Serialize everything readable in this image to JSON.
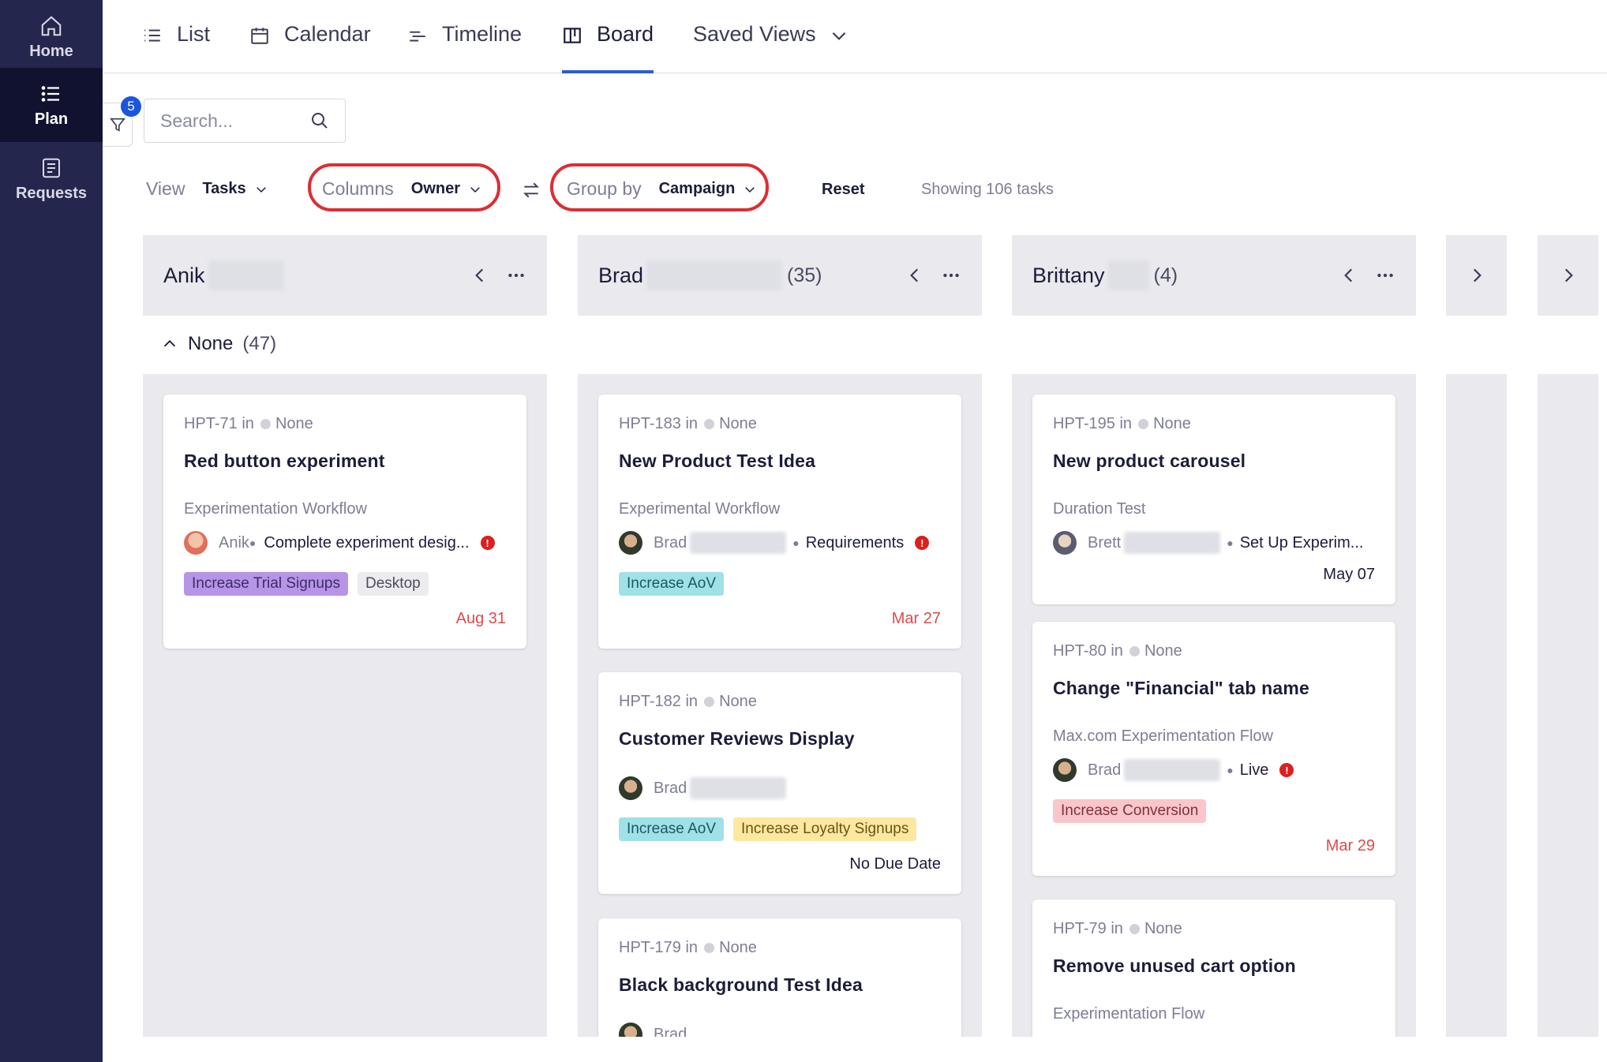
{
  "sidebar": {
    "items": [
      {
        "label": "Home",
        "icon": "home-icon"
      },
      {
        "label": "Plan",
        "icon": "list-icon"
      },
      {
        "label": "Requests",
        "icon": "document-icon"
      }
    ]
  },
  "tabs": [
    {
      "label": "List",
      "icon": "list-icon"
    },
    {
      "label": "Calendar",
      "icon": "calendar-icon"
    },
    {
      "label": "Timeline",
      "icon": "timeline-icon"
    },
    {
      "label": "Board",
      "icon": "board-icon"
    },
    {
      "label": "Saved Views",
      "icon": "chevron-down-icon"
    }
  ],
  "filter": {
    "badge_count": "5"
  },
  "search": {
    "placeholder": "Search..."
  },
  "toolbar": {
    "view_label": "View",
    "view_value": "Tasks",
    "columns_label": "Columns",
    "columns_value": "Owner",
    "group_label": "Group by",
    "group_value": "Campaign",
    "reset": "Reset",
    "showing": "Showing 106 tasks"
  },
  "columns": [
    {
      "name": "Anik",
      "count": ""
    },
    {
      "name": "Brad",
      "count": "(35)"
    },
    {
      "name": "Brittany",
      "count": "(4)"
    }
  ],
  "group": {
    "name": "None",
    "count": "(47)"
  },
  "cards": {
    "anik": [
      {
        "key": "HPT-71 in",
        "campaign": "None",
        "title": "Red button experiment",
        "workflow": "Experimentation Workflow",
        "owner": "Anik",
        "status": "Complete experiment desig...",
        "tags": [
          "Increase Trial Signups",
          "Desktop"
        ],
        "due": "Aug 31"
      }
    ],
    "brad": [
      {
        "key": "HPT-183 in",
        "campaign": "None",
        "title": "New Product Test Idea",
        "workflow": "Experimental Workflow",
        "owner": "Brad",
        "status": "Requirements",
        "tags": [
          "Increase AoV"
        ],
        "due": "Mar 27"
      },
      {
        "key": "HPT-182 in",
        "campaign": "None",
        "title": "Customer Reviews Display",
        "owner": "Brad",
        "tags": [
          "Increase AoV",
          "Increase Loyalty Signups"
        ],
        "due": "No Due Date"
      },
      {
        "key": "HPT-179 in",
        "campaign": "None",
        "title": "Black background Test Idea",
        "owner": "Brad"
      }
    ],
    "brittany": [
      {
        "key": "HPT-195 in",
        "campaign": "None",
        "title": "New product carousel",
        "workflow": "Duration Test",
        "owner": "Brett",
        "status": "Set Up Experim...",
        "due": "May 07"
      },
      {
        "key": "HPT-80 in",
        "campaign": "None",
        "title": "Change \"Financial\" tab name",
        "workflow": "Max.com Experimentation Flow",
        "owner": "Brad",
        "status": "Live",
        "tags": [
          "Increase Conversion"
        ],
        "due": "Mar 29"
      },
      {
        "key": "HPT-79 in",
        "campaign": "None",
        "title": "Remove unused cart option",
        "workflow": "Experimentation Flow"
      }
    ]
  },
  "colors": {
    "sidebar": "#25264d",
    "accent": "#2a5bd7",
    "highlight": "#dc2e33",
    "due_red": "#dd4b4b"
  }
}
